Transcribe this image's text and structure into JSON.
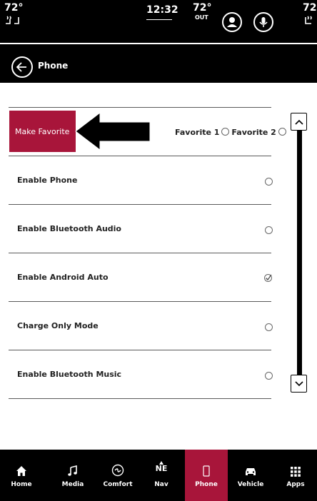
{
  "status_bar": {
    "left_temp": "72°",
    "clock": "12:32",
    "outside_temp": "72°",
    "outside_label": "OUT",
    "right_temp": "72°"
  },
  "header": {
    "title": "Phone"
  },
  "favorite": {
    "button_label": "Make Favorite",
    "option1": "Favorite 1",
    "option2": "Favorite 2"
  },
  "rows": [
    {
      "label": "Enable Phone",
      "state": "radio-empty"
    },
    {
      "label": "Enable Bluetooth Audio",
      "state": "radio-empty"
    },
    {
      "label": "Enable Android Auto",
      "state": "checked"
    },
    {
      "label": "Charge Only Mode",
      "state": "radio-empty"
    },
    {
      "label": "Enable Bluetooth Music",
      "state": "radio-empty"
    }
  ],
  "nav": [
    {
      "label": "Home",
      "icon": "home-icon"
    },
    {
      "label": "Media",
      "icon": "music-note-icon"
    },
    {
      "label": "Comfort",
      "icon": "comfort-icon"
    },
    {
      "label": "Nav",
      "icon": "compass-icon",
      "heading": "NE"
    },
    {
      "label": "Phone",
      "icon": "phone-icon",
      "active": true
    },
    {
      "label": "Vehicle",
      "icon": "car-icon"
    },
    {
      "label": "Apps",
      "icon": "grid-icon"
    }
  ],
  "colors": {
    "accent": "#a8153a",
    "bar": "#000000"
  }
}
